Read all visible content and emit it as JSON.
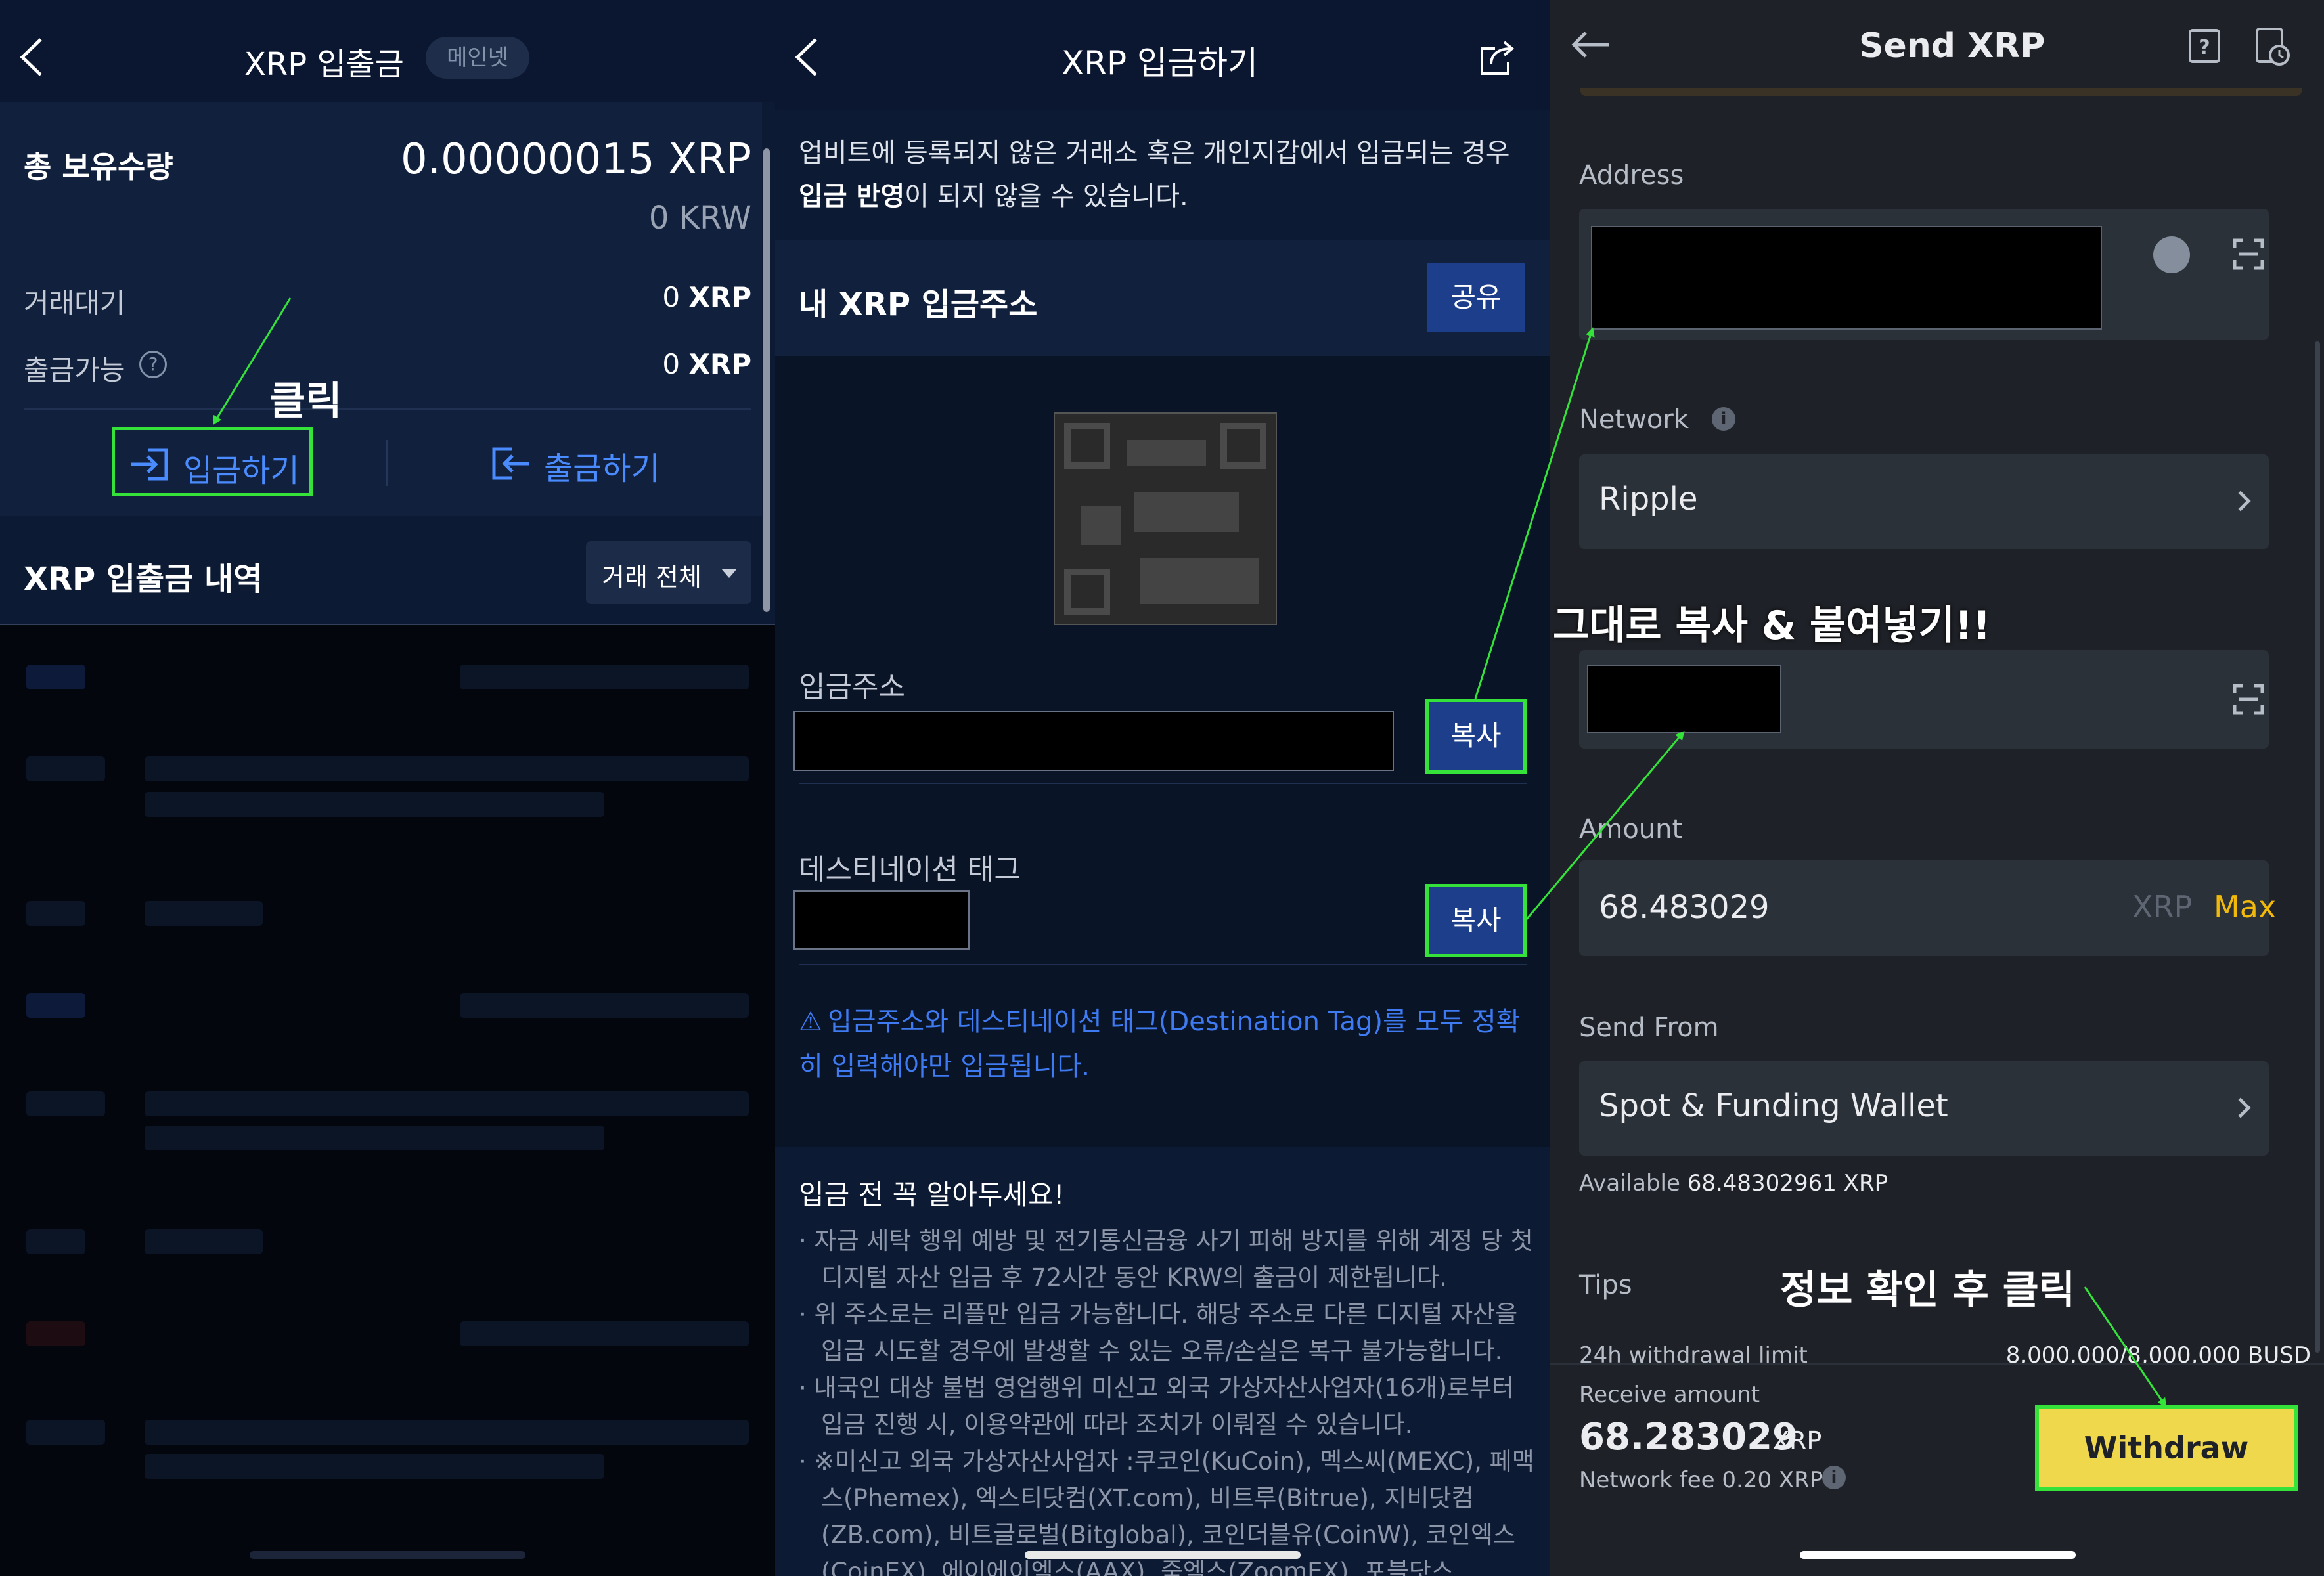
{
  "panel1": {
    "title": "XRP 입출금",
    "network_badge": "메인넷",
    "total_label": "총 보유수량",
    "total_value": "0.00000015 XRP",
    "total_krw": "0 KRW",
    "pending_label": "거래대기",
    "pending_value": "0",
    "pending_unit": "XRP",
    "available_label": "출금가능",
    "available_value": "0",
    "available_unit": "XRP",
    "help_glyph": "?",
    "deposit_label": "입금하기",
    "withdraw_label": "출금하기",
    "history_title": "XRP 입출금 내역",
    "filter_label": "거래 전체",
    "annotation": "클릭",
    "accent_color": "#4a8cff",
    "highlight_color": "#35e23a"
  },
  "panel2": {
    "title": "XRP 입금하기",
    "notice_pre": "업비트에 등록되지 않은 거래소 혹은 개인지갑에서 입금되는 경우 ",
    "notice_bold": "입금 반영",
    "notice_post": "이 되지 않을 수 있습니다.",
    "address_section_title": "내 XRP 입금주소",
    "share_label": "공유",
    "address_label": "입금주소",
    "copy_label": "복사",
    "tag_label": "데스티네이션 태그",
    "warning_icon": "⚠",
    "warning": "입금주소와 데스티네이션 태그(Destination Tag)를 모두 정확히 입력해야만 입금됩니다.",
    "notes_title": "입금 전 꼭 알아두세요!",
    "notes": [
      "자금 세탁 행위 예방 및 전기통신금융 사기 피해 방지를 위해 계정 당 첫 디지털 자산 입금 후 72시간 동안 KRW의 출금이 제한됩니다.",
      "위 주소로는 리플만 입금 가능합니다. 해당 주소로 다른 디지털 자산을 입금 시도할 경우에 발생할 수 있는 오류/손실은 복구 불가능합니다.",
      "내국인 대상 불법 영업행위 미신고 외국 가상자산사업자(16개)로부터 입금 진행 시, 이용약관에 따라 조치가 이뤄질 수 있습니다.",
      "※미신고 외국 가상자산사업자 :쿠코인(KuCoin), 멕스씨(MEXC), 페맥스(Phemex), 엑스티닷컴(XT.com), 비트루(Bitrue), 지비닷컴(ZB.com), 비트글로벌(Bitglobal), 코인더블유(CoinW), 코인엑스(CoinEX), 에이에이엑스(AAX), 줌엑스(ZoomEX), 포블닷스"
    ],
    "bullet": "·"
  },
  "panel3": {
    "title": "Send XRP",
    "address_label": "Address",
    "network_label": "Network",
    "info_glyph": "i",
    "network_value": "Ripple",
    "annotation_copy": "그대로 복사 & 붙여넣기!!",
    "amount_label": "Amount",
    "amount_value": "68.483029",
    "amount_unit": "XRP",
    "max_label": "Max",
    "send_from_label": "Send From",
    "send_from_value": "Spot & Funding Wallet",
    "available_label": "Available",
    "available_value": "68.48302961 XRP",
    "tips_label": "Tips",
    "annotation_click": "정보 확인 후 클릭",
    "limit_label": "24h withdrawal limit",
    "limit_value": "8,000,000/8,000,000 BUSD",
    "receive_label": "Receive amount",
    "receive_value": "68.283029",
    "receive_unit": "XRP",
    "fee_label": "Network fee 0.20 XRP",
    "withdraw_label": "Withdraw",
    "brand_yellow": "#f0b90b",
    "button_yellow": "#f0d84c"
  }
}
